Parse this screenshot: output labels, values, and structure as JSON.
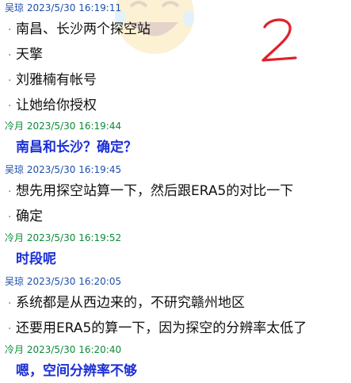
{
  "messages": [
    {
      "sender": "吴琼",
      "time": "2023/5/30 16:19:11",
      "lines": [
        "南昌、长沙两个探空站",
        "天擎",
        "刘雅楠有帐号",
        "让她给你授权"
      ]
    },
    {
      "sender": "冷月",
      "time": "2023/5/30 16:19:44",
      "lines": [
        "南昌和长沙？确定？"
      ]
    },
    {
      "sender": "吴琼",
      "time": "2023/5/30 16:19:45",
      "lines": [
        "想先用探空站算一下，然后跟ERA5的对比一下",
        "确定"
      ]
    },
    {
      "sender": "冷月",
      "time": "2023/5/30 16:19:52",
      "lines": [
        "时段呢"
      ]
    },
    {
      "sender": "吴琼",
      "time": "2023/5/30 16:20:05",
      "lines": [
        "系统都是从西边来的，不研究赣州地区",
        "还要用ERA5的算一下，因为探空的分辨率太低了"
      ]
    },
    {
      "sender": "冷月",
      "time": "2023/5/30 16:20:40",
      "lines": [
        "嗯，空间分辨率不够"
      ]
    }
  ],
  "annotation": {
    "handwritten_text": "2",
    "color": "#e0202a"
  },
  "colors": {
    "sender_a": "#1f4fa8",
    "sender_b": "#0b8a3a",
    "reply_text": "#1b2fd6",
    "body_text": "#111111"
  },
  "watermark": {
    "icon": "laughing-emoji-icon"
  }
}
